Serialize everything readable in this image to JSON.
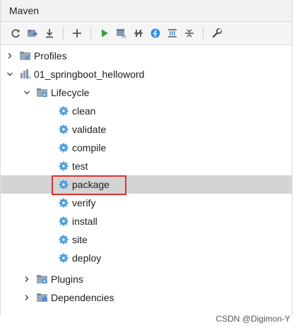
{
  "panel": {
    "title": "Maven"
  },
  "toolbar": {
    "buttons": [
      {
        "icon": "reload-icon"
      },
      {
        "icon": "generate-sources-icon"
      },
      {
        "icon": "download-icon"
      },
      {
        "icon": "add-icon"
      },
      {
        "icon": "run-icon"
      },
      {
        "icon": "execute-goal-icon"
      },
      {
        "icon": "toggle-offline-icon"
      },
      {
        "icon": "skip-tests-icon"
      },
      {
        "icon": "show-dependencies-icon"
      },
      {
        "icon": "collapse-all-icon"
      },
      {
        "icon": "settings-icon"
      }
    ]
  },
  "tree": {
    "profiles": "Profiles",
    "project": "01_springboot_helloword",
    "lifecycle": "Lifecycle",
    "goals": [
      "clean",
      "validate",
      "compile",
      "test",
      "package",
      "verify",
      "install",
      "site",
      "deploy"
    ],
    "selected_goal": "package",
    "plugins": "Plugins",
    "dependencies": "Dependencies"
  },
  "colors": {
    "run_green": "#3d9b3d",
    "gear_blue": "#4a9ee0",
    "highlight_red": "#e03030",
    "selection_gray": "#d4d4d4"
  },
  "watermark": "CSDN @Digimon-Y"
}
